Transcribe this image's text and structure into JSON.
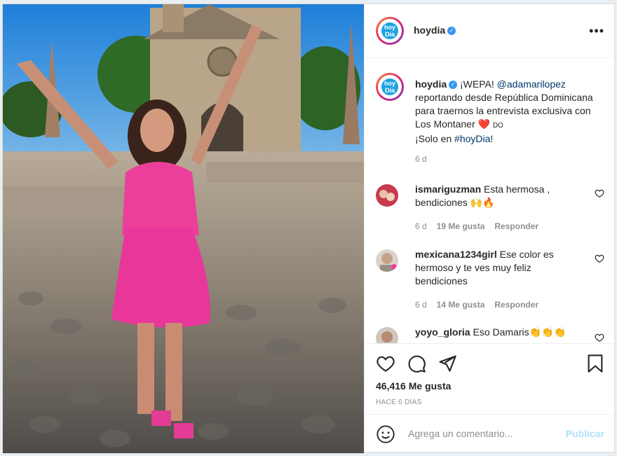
{
  "post": {
    "username": "hoydia",
    "logo_text": "hoy\nDía",
    "caption": {
      "intro": "¡WEPA!",
      "mention": "@adamarilopez",
      "text": "reportando desde República Dominicana para traernos la entrevista exclusiva con Los Montaner",
      "heart": "❤️",
      "flag": "DO",
      "line2_prefix": "¡Solo en",
      "hashtag": "#hoyDia",
      "line2_suffix": "!",
      "age": "6 d"
    },
    "comments": [
      {
        "user": "ismariguzman",
        "text": "Esta hermosa , bendiciones 🙌🔥",
        "age": "6 d",
        "likes": "19 Me gusta",
        "reply": "Responder"
      },
      {
        "user": "mexicana1234girl",
        "text": "Ese color es hermoso y te ves muy feliz bendiciones",
        "age": "6 d",
        "likes": "14 Me gusta",
        "reply": "Responder"
      },
      {
        "user": "yoyo_gloria",
        "text": "Eso Damaris👏👏👏"
      }
    ],
    "likes_count": "46,416 Me gusta",
    "posted": "HACE 6 DÍAS",
    "add_comment_placeholder": "Agrega un comentario...",
    "publish_label": "Publicar"
  },
  "colors": {
    "accent": "#3897f0",
    "pink_dress": "#ec3f9a",
    "publish_disabled": "#b2dffc"
  },
  "icons": [
    "more-options-icon",
    "verified-icon",
    "heart-icon",
    "comment-icon",
    "share-icon",
    "bookmark-icon",
    "emoji-icon"
  ]
}
